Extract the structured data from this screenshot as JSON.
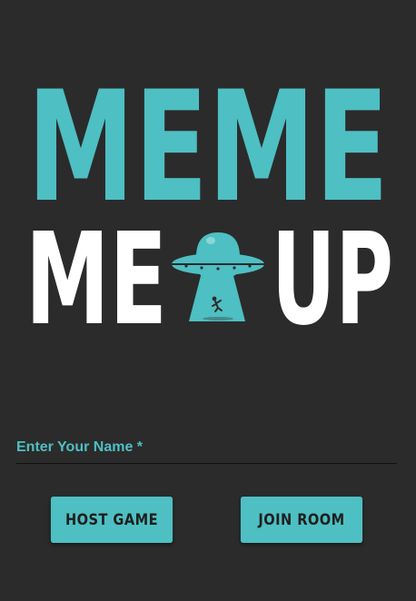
{
  "logo": {
    "line1": "MEME",
    "line2_left": "ME",
    "line2_right": "UP",
    "accent_color": "#4ebfc3",
    "text_color": "#ffffff",
    "icon": "ufo-abduction-icon"
  },
  "form": {
    "name_label": "Enter Your Name *",
    "name_value": ""
  },
  "buttons": {
    "host_label": "Host Game",
    "join_label": "Join Room"
  },
  "colors": {
    "background": "#2b2b2b",
    "accent": "#4ebfc3",
    "button_text": "#1f1f1f"
  }
}
